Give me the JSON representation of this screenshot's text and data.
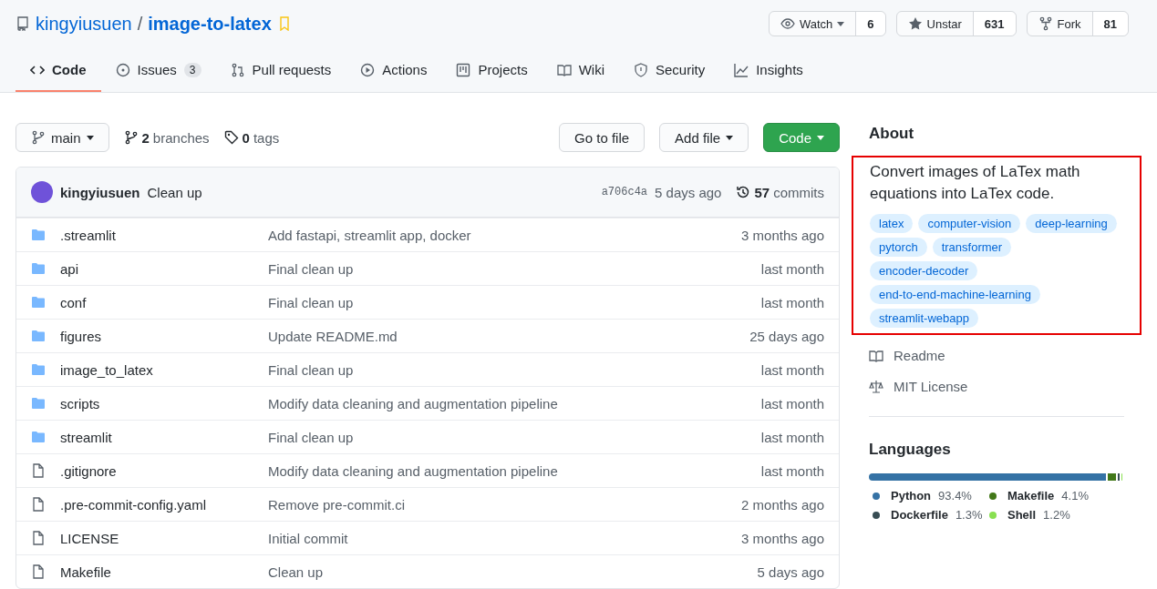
{
  "repo": {
    "owner": "kingyiusuen",
    "separator": "/",
    "name": "image-to-latex"
  },
  "actions": [
    {
      "kind": "watch",
      "label": "Watch",
      "count": "6"
    },
    {
      "kind": "star",
      "label": "Unstar",
      "count": "631"
    },
    {
      "kind": "fork",
      "label": "Fork",
      "count": "81"
    }
  ],
  "tabs": [
    {
      "kind": "code",
      "label": "Code",
      "selected": true
    },
    {
      "kind": "issues",
      "label": "Issues",
      "count": "3",
      "selected": false
    },
    {
      "kind": "pulls",
      "label": "Pull requests",
      "selected": false
    },
    {
      "kind": "actions",
      "label": "Actions",
      "selected": false
    },
    {
      "kind": "projects",
      "label": "Projects",
      "selected": false
    },
    {
      "kind": "wiki",
      "label": "Wiki",
      "selected": false
    },
    {
      "kind": "security",
      "label": "Security",
      "selected": false
    },
    {
      "kind": "insights",
      "label": "Insights",
      "selected": false
    }
  ],
  "branch_bar": {
    "branch": "main",
    "branches_count": "2",
    "branches_label": "branches",
    "tags_count": "0",
    "tags_label": "tags",
    "go_to_file": "Go to file",
    "add_file": "Add file",
    "code": "Code"
  },
  "commit": {
    "author": "kingyiusuen",
    "message": "Clean up",
    "sha": "a706c4a",
    "time": "5 days ago",
    "commits_count": "57",
    "commits_label": "commits"
  },
  "files": [
    {
      "kind": "dir",
      "name": ".streamlit",
      "message": "Add fastapi, streamlit app, docker",
      "time": "3 months ago"
    },
    {
      "kind": "dir",
      "name": "api",
      "message": "Final clean up",
      "time": "last month"
    },
    {
      "kind": "dir",
      "name": "conf",
      "message": "Final clean up",
      "time": "last month"
    },
    {
      "kind": "dir",
      "name": "figures",
      "message": "Update README.md",
      "time": "25 days ago"
    },
    {
      "kind": "dir",
      "name": "image_to_latex",
      "message": "Final clean up",
      "time": "last month"
    },
    {
      "kind": "dir",
      "name": "scripts",
      "message": "Modify data cleaning and augmentation pipeline",
      "time": "last month"
    },
    {
      "kind": "dir",
      "name": "streamlit",
      "message": "Final clean up",
      "time": "last month"
    },
    {
      "kind": "file",
      "name": ".gitignore",
      "message": "Modify data cleaning and augmentation pipeline",
      "time": "last month"
    },
    {
      "kind": "file",
      "name": ".pre-commit-config.yaml",
      "message": "Remove pre-commit.ci",
      "time": "2 months ago"
    },
    {
      "kind": "file",
      "name": "LICENSE",
      "message": "Initial commit",
      "time": "3 months ago"
    },
    {
      "kind": "file",
      "name": "Makefile",
      "message": "Clean up",
      "time": "5 days ago"
    }
  ],
  "about": {
    "title": "About",
    "highlighted": true,
    "description": "Convert images of LaTex math equations into LaTex code.",
    "topics": [
      "latex",
      "computer-vision",
      "deep-learning",
      "pytorch",
      "transformer",
      "encoder-decoder",
      "end-to-end-machine-learning",
      "streamlit-webapp"
    ],
    "links": [
      {
        "kind": "readme",
        "label": "Readme"
      },
      {
        "kind": "license",
        "label": "MIT License"
      }
    ]
  },
  "languages": {
    "title": "Languages",
    "items": [
      {
        "name": "Python",
        "percent": "93.4%",
        "color": "#3572a5"
      },
      {
        "name": "Makefile",
        "percent": "4.1%",
        "color": "#427819"
      },
      {
        "name": "Dockerfile",
        "percent": "1.3%",
        "color": "#384d54"
      },
      {
        "name": "Shell",
        "percent": "1.2%",
        "color": "#89e051"
      }
    ]
  }
}
